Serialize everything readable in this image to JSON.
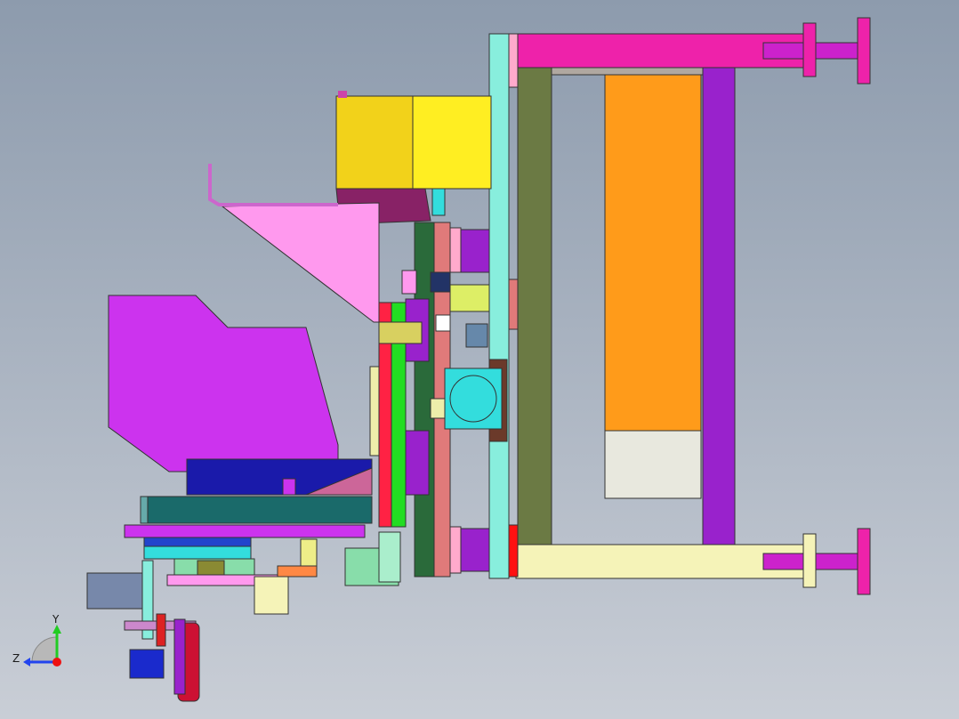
{
  "view": {
    "background_top": "#8d9bad",
    "background_bottom": "#c9ced6",
    "content": "cad-assembly-side-view"
  },
  "triad": {
    "y_label": "Y",
    "z_label": "Z",
    "y_color": "#22cc22",
    "z_color": "#2244ee",
    "x_color": "#ee1111"
  },
  "colors": {
    "frame_magenta": "#ee22aa",
    "frame_purple": "#9922cc",
    "frame_cream": "#f5f3b8",
    "plate_cyan": "#88eedd",
    "plate_olive": "#6b7a44",
    "block_orange": "#ff9b1a",
    "block_beige": "#e8e8de",
    "roll_yellow": "#f2d21a",
    "hopper_pink": "#ff99ee",
    "hopper_purple": "#cc33ee",
    "base_navy": "#1a1aaa",
    "rail_teal": "#1a6a6a",
    "strip_red": "#ff2244",
    "strip_green": "#22dd22",
    "plate_salmon": "#e07a7a",
    "motor_cyan": "#33dddd"
  }
}
